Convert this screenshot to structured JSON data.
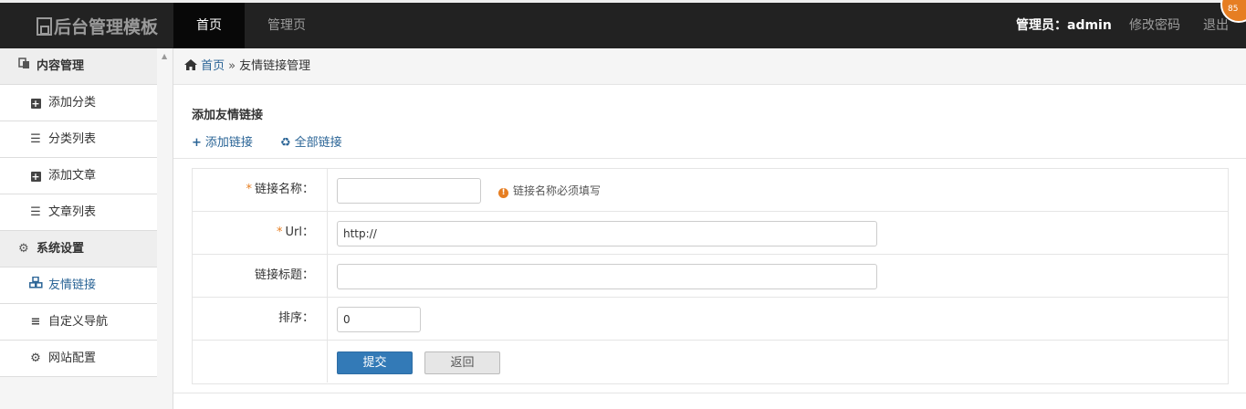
{
  "header": {
    "logo": "后台管理模板",
    "tabs": [
      {
        "label": "首页"
      },
      {
        "label": "管理页"
      }
    ],
    "admin_label": "管理员：admin",
    "change_password": "修改密码",
    "logout": "退出",
    "corner_badge": "85"
  },
  "sidebar": {
    "section1": "内容管理",
    "items1": [
      {
        "label": "添加分类"
      },
      {
        "label": "分类列表"
      },
      {
        "label": "添加文章"
      },
      {
        "label": "文章列表"
      }
    ],
    "section2": "系统设置",
    "items2": [
      {
        "label": "友情链接"
      },
      {
        "label": "自定义导航"
      },
      {
        "label": "网站配置"
      }
    ]
  },
  "breadcrumb": {
    "home": "首页",
    "separator": "»",
    "current": "友情链接管理"
  },
  "panel": {
    "title": "添加友情链接",
    "add_link": "添加链接",
    "all_links": "全部链接"
  },
  "form": {
    "required_mark": "*",
    "name_label": "链接名称：",
    "name_value": "",
    "name_hint_icon": "!",
    "name_hint": "链接名称必须填写",
    "url_label": "Url：",
    "url_value": "http://",
    "title_label": "链接标题：",
    "title_value": "",
    "order_label": "排序：",
    "order_value": "0",
    "submit": "提交",
    "back": "返回"
  },
  "colors": {
    "accent": "#337ab7",
    "link": "#2a6496",
    "topbar": "#222222",
    "warning": "#e67e22"
  }
}
